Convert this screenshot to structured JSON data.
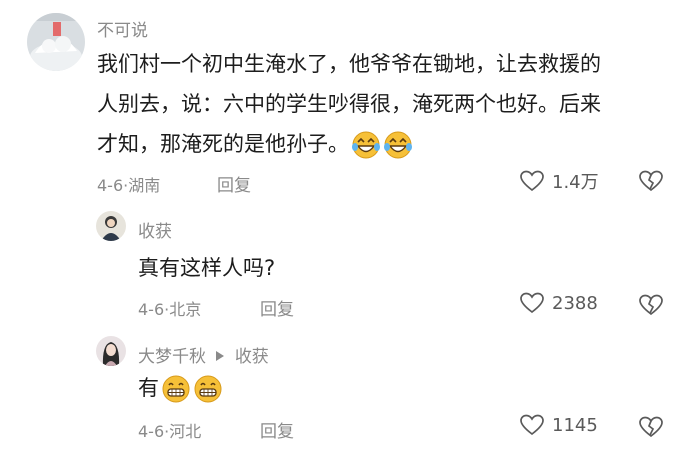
{
  "comments": [
    {
      "username": "不可说",
      "text_line1": "我们村一个初中生淹水了，他爷爷在锄地，让去救援的",
      "text_line2": "人别去，说：六中的学生吵得很，淹死两个也好。后来",
      "text_line3": "才知，那淹死的是他孙子。",
      "date": "4-6",
      "location": "湖南",
      "reply_label": "回复",
      "likes": "1.4万",
      "emoji": [
        "laughing-tears-emoji",
        "laughing-tears-emoji"
      ]
    },
    {
      "username": "收获",
      "text": "真有这样人吗?",
      "date": "4-6",
      "location": "北京",
      "reply_label": "回复",
      "likes": "2388"
    },
    {
      "username": "大梦千秋",
      "reply_to": "收获",
      "text": "有",
      "date": "4-6",
      "location": "河北",
      "reply_label": "回复",
      "likes": "1145",
      "emoji": [
        "grinning-emoji",
        "grinning-emoji"
      ]
    }
  ],
  "separator": "·",
  "icons": {
    "like": "heart-outline-icon",
    "dislike": "broken-heart-icon",
    "reply_arrow": "triangle-right-icon"
  },
  "colors": {
    "text": "#1d1d1d",
    "muted": "#8a8a8a",
    "emoji": "#f6c038"
  }
}
